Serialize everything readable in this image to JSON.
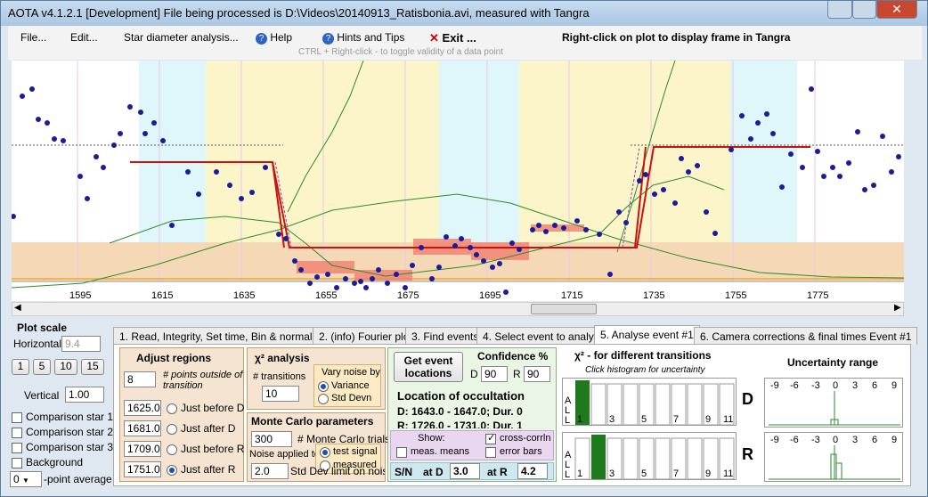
{
  "window": {
    "title": "AOTA v4.1.2.1 [Development]    File being processed is D:\\Videos\\20140913_Ratisbonia.avi, measured with Tangra"
  },
  "menu": {
    "file": "File...",
    "edit": "Edit...",
    "star": "Star diameter analysis...",
    "help": "Help",
    "hints": "Hints and Tips",
    "exit": "Exit ...",
    "note": "Right-click on plot to display frame in Tangra",
    "hint": "CTRL + Right-click  -  to toggle validity of a data point"
  },
  "axis": {
    "ticks": [
      "1595",
      "1615",
      "1635",
      "1655",
      "1675",
      "1695",
      "1715",
      "1735",
      "1755",
      "1775"
    ]
  },
  "plot_scale": {
    "title": "Plot scale",
    "horizontal_label": "Horizontal",
    "horizontal_value": "9.4",
    "buttons": [
      "1",
      "5",
      "10",
      "15"
    ],
    "vertical_label": "Vertical",
    "vertical_value": "1.00"
  },
  "checks": [
    "Comparison star 1",
    "Comparison star 2",
    "Comparison star 3",
    "Background"
  ],
  "avg": {
    "value": "0",
    "label": "-point average"
  },
  "tabs": [
    "1.  Read, Integrity, Set time, Bin & normalise",
    "2.  (info)  Fourier plot",
    "3. Find events",
    "4. Select event to analyse",
    "5.  Analyse event #1",
    "6. Camera corrections & final times Event #1"
  ],
  "adjust": {
    "title": "Adjust regions",
    "points_value": "8",
    "points_label": "# points outside of transition",
    "rows": [
      {
        "value": "1625.0",
        "label": "Just before D"
      },
      {
        "value": "1681.0",
        "label": "Just after D"
      },
      {
        "value": "1709.0",
        "label": "Just before R"
      },
      {
        "value": "1751.0",
        "label": "Just after R"
      }
    ]
  },
  "chi": {
    "title": "χ² analysis",
    "transitions_label": "# transitions",
    "transitions_value": "10",
    "noise_label": "Vary noise by",
    "opt1": "Variance",
    "opt2": "Std Devn"
  },
  "mc": {
    "title": "Monte Carlo parameters",
    "trials_value": "300",
    "trials_label": "# Monte Carlo trials",
    "noise_applied": "Noise applied to",
    "opt1": "test signal",
    "opt2": "measured",
    "sd_value": "2.0",
    "sd_label": "Std Dev limit on noise"
  },
  "loc": {
    "button": "Get event locations",
    "conf_title": "Confidence %",
    "d_label": "D",
    "d_value": "90",
    "r_label": "R",
    "r_value": "90",
    "title": "Location of occultation",
    "d_text": "D: 1643.0 - 1647.0; Dur. 0",
    "r_text": "R: 1726.0 - 1731.0; Dur. 1",
    "show": "Show:",
    "meas": "meas. means",
    "cross": "cross-corrln",
    "err": "error bars",
    "sn": "S/N",
    "atd": "at D",
    "atd_value": "3.0",
    "atr": "at R",
    "atr_value": "4.2"
  },
  "chi2": {
    "title": "χ² - for different transitions",
    "subtitle": "Click histogram for uncertainty",
    "all": "A L L",
    "d": "D",
    "r": "R",
    "ticks": [
      "1",
      "3",
      "5",
      "7",
      "9",
      "11"
    ]
  },
  "unc": {
    "title": "Uncertainty range",
    "ticks": [
      "-9",
      "-6",
      "-3",
      "0",
      "3",
      "6",
      "9"
    ]
  },
  "colors": {
    "accent": "#1a4fb0",
    "exit": "#cc0000",
    "region_yellow": "#fbf5c9",
    "region_cyan": "#dff7fb",
    "baseline": "#f5d8b5"
  }
}
